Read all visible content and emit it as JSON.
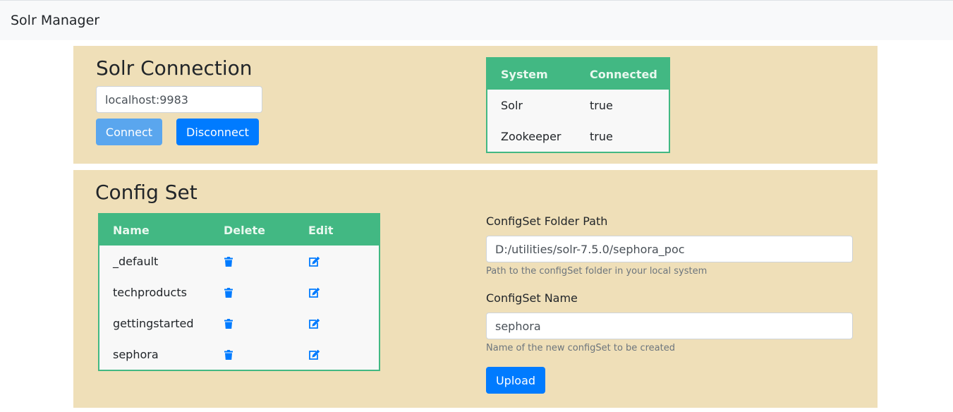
{
  "navbar": {
    "brand": "Solr Manager"
  },
  "connection": {
    "title": "Solr Connection",
    "host_value": "localhost:9983",
    "connect_label": "Connect",
    "disconnect_label": "Disconnect",
    "status_table": {
      "headers": [
        "System",
        "Connected"
      ],
      "rows": [
        {
          "system": "Solr",
          "connected": "true"
        },
        {
          "system": "Zookeeper",
          "connected": "true"
        }
      ]
    }
  },
  "configset": {
    "title": "Config Set",
    "table": {
      "headers": [
        "Name",
        "Delete",
        "Edit"
      ],
      "rows": [
        {
          "name": "_default",
          "delete_icon": "trash-icon",
          "edit_icon": "edit-icon"
        },
        {
          "name": "techproducts",
          "delete_icon": "trash-icon",
          "edit_icon": "edit-icon"
        },
        {
          "name": "gettingstarted",
          "delete_icon": "trash-icon",
          "edit_icon": "edit-icon"
        },
        {
          "name": "sephora",
          "delete_icon": "trash-icon",
          "edit_icon": "edit-icon"
        }
      ]
    },
    "form": {
      "folder_label": "ConfigSet Folder Path",
      "folder_value": "D:/utilities/solr-7.5.0/sephora_poc",
      "folder_help": "Path to the configSet folder in your local system",
      "name_label": "ConfigSet Name",
      "name_value": "sephora",
      "name_help": "Name of the new configSet to be created",
      "upload_label": "Upload"
    }
  },
  "colors": {
    "panel_bg": "#efdfb8",
    "table_accent": "#42b883",
    "primary": "#007bff"
  }
}
